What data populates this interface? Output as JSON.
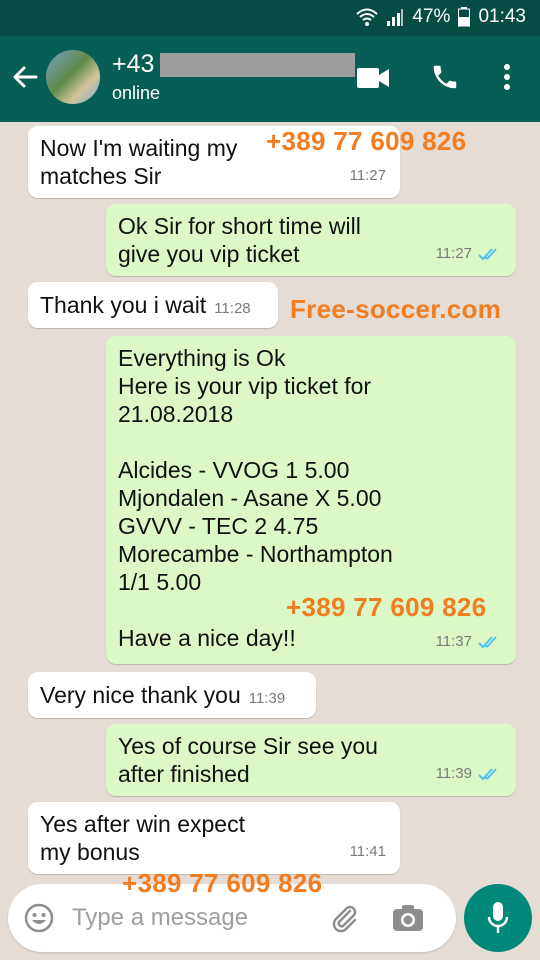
{
  "status_bar": {
    "battery": "47%",
    "time": "01:43"
  },
  "header": {
    "contact_name": "+43",
    "contact_status": "online"
  },
  "icons": {
    "back": "arrow-left-icon",
    "video": "videocam-icon",
    "call": "phone-icon",
    "menu": "more-vert-icon",
    "emoji": "emoji-icon",
    "attach": "paperclip-icon",
    "camera": "camera-icon",
    "mic": "mic-icon"
  },
  "colors": {
    "header": "#075e54",
    "status_bar": "#054d44",
    "outgoing": "#dcf8c6",
    "incoming": "#ffffff",
    "overlay_text": "#f27c20",
    "mic_button": "#00897b",
    "read_ticks": "#4fc3f7"
  },
  "messages": [
    {
      "direction": "in",
      "text": "Now I'm waiting my\nmatches Sir",
      "time": "11:27"
    },
    {
      "direction": "out",
      "text": "Ok Sir for short time will\ngive you vip ticket",
      "time": "11:27",
      "read": true
    },
    {
      "direction": "in",
      "text": "Thank you i wait",
      "time": "11:28"
    },
    {
      "direction": "out",
      "text": "Everything is Ok\nHere is your vip ticket for\n21.08.2018\n\nAlcides - VVOG  1  5.00\nMjondalen - Asane  X  5.00\nGVVV - TEC  2  4.75\nMorecambe - Northampton\n1/1 5.00\n\nHave a nice day!!",
      "time": "11:37",
      "read": true
    },
    {
      "direction": "in",
      "text": "Very nice thank you",
      "time": "11:39"
    },
    {
      "direction": "out",
      "text": "Yes of course Sir see you\nafter finished",
      "time": "11:39",
      "read": true
    },
    {
      "direction": "in",
      "text": "Yes after win expect\nmy bonus",
      "time": "11:41"
    }
  ],
  "overlays": [
    "+389 77 609 826",
    "Free-soccer.com",
    "+389 77 609 826",
    "+389 77 609 826"
  ],
  "composer": {
    "placeholder": "Type a message"
  }
}
